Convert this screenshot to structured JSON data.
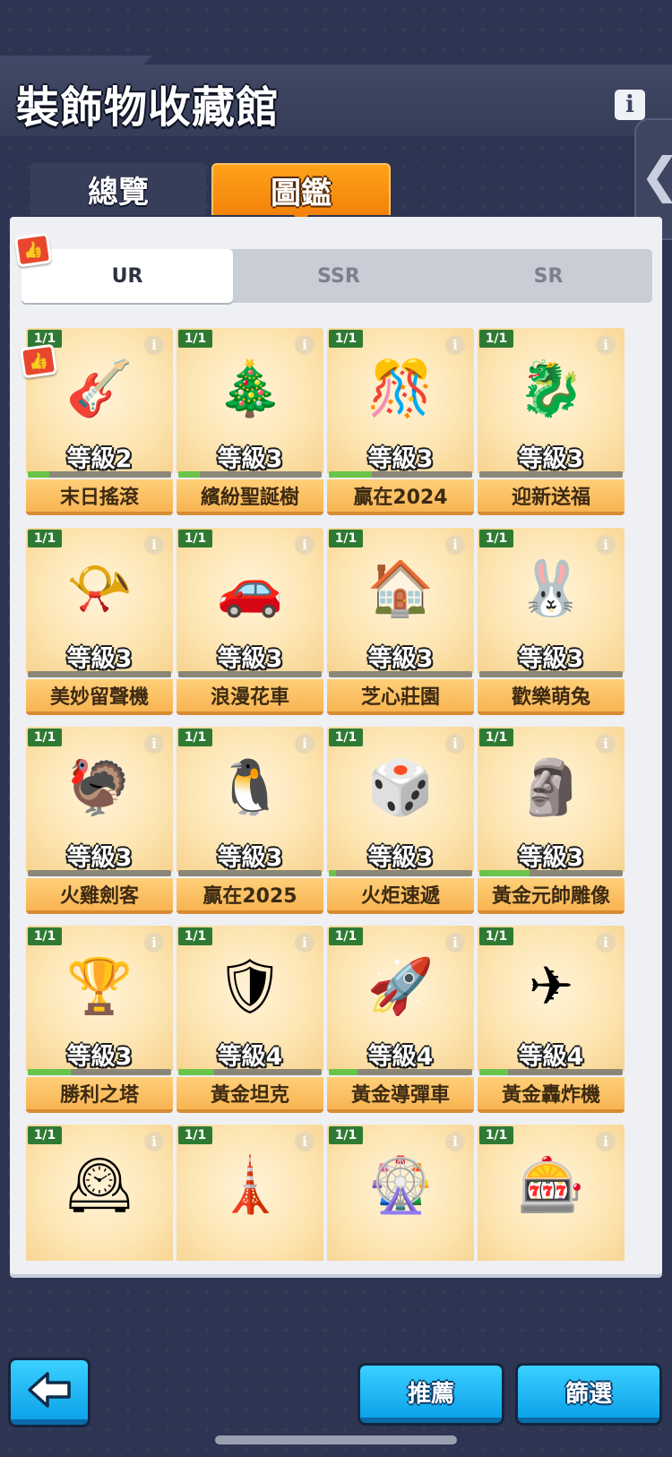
{
  "header": {
    "title": "裝飾物收藏館",
    "info_glyph": "i",
    "side_chevron": "❮"
  },
  "tabs": [
    {
      "label": "總覽",
      "active": false
    },
    {
      "label": "圖鑑",
      "active": true
    }
  ],
  "rarity_tabs": [
    {
      "label": "UR",
      "active": true
    },
    {
      "label": "SSR",
      "active": false
    },
    {
      "label": "SR",
      "active": false
    }
  ],
  "colors": {
    "accent_orange": "#f2820a",
    "button_blue": "#0ea2ea",
    "count_badge_green": "#2f7a33",
    "progress_green": "#6bc44a"
  },
  "items": [
    {
      "count": "1/1",
      "level": "等級2",
      "name": "末日搖滾",
      "progress": 0.15,
      "icon": "guitar-zombie-icon",
      "glyph": "🎸"
    },
    {
      "count": "1/1",
      "level": "等級3",
      "name": "繽紛聖誕樹",
      "progress": 0.15,
      "icon": "christmas-tree-icon",
      "glyph": "🎄"
    },
    {
      "count": "1/1",
      "level": "等級3",
      "name": "贏在2024",
      "progress": 0.3,
      "icon": "2024-sign-icon",
      "glyph": "🎊"
    },
    {
      "count": "1/1",
      "level": "等級3",
      "name": "迎新送福",
      "progress": 0.0,
      "icon": "dragon-icon",
      "glyph": "🐉"
    },
    {
      "count": "1/1",
      "level": "等級3",
      "name": "美妙留聲機",
      "progress": 0.0,
      "icon": "gramophone-icon",
      "glyph": "📯"
    },
    {
      "count": "1/1",
      "level": "等級3",
      "name": "浪漫花車",
      "progress": 0.0,
      "icon": "pink-car-icon",
      "glyph": "🚗"
    },
    {
      "count": "1/1",
      "level": "等級3",
      "name": "芝心莊園",
      "progress": 0.0,
      "icon": "bow-house-icon",
      "glyph": "🏠"
    },
    {
      "count": "1/1",
      "level": "等級3",
      "name": "歡樂萌兔",
      "progress": 0.0,
      "icon": "bunny-icon",
      "glyph": "🐰"
    },
    {
      "count": "1/1",
      "level": "等級3",
      "name": "火雞劍客",
      "progress": 0.0,
      "icon": "turkey-icon",
      "glyph": "🦃"
    },
    {
      "count": "1/1",
      "level": "等級3",
      "name": "贏在2025",
      "progress": 0.0,
      "icon": "2025-sign-icon",
      "glyph": "🐧"
    },
    {
      "count": "1/1",
      "level": "等級3",
      "name": "火炬速遞",
      "progress": 0.05,
      "icon": "torch-statue-icon",
      "glyph": "🎲"
    },
    {
      "count": "1/1",
      "level": "等級3",
      "name": "黃金元帥雕像",
      "progress": 0.35,
      "icon": "marshal-statue-icon",
      "glyph": "🗿"
    },
    {
      "count": "1/1",
      "level": "等級3",
      "name": "勝利之塔",
      "progress": 0.3,
      "icon": "victory-tower-icon",
      "glyph": "🏆"
    },
    {
      "count": "1/1",
      "level": "等級4",
      "name": "黃金坦克",
      "progress": 0.25,
      "icon": "golden-tank-icon",
      "glyph": "🛡"
    },
    {
      "count": "1/1",
      "level": "等級4",
      "name": "黃金導彈車",
      "progress": 0.2,
      "icon": "golden-missile-truck-icon",
      "glyph": "🚀"
    },
    {
      "count": "1/1",
      "level": "等級4",
      "name": "黃金轟炸機",
      "progress": 0.2,
      "icon": "golden-bomber-icon",
      "glyph": "✈"
    },
    {
      "count": "1/1",
      "level": "",
      "name": "",
      "progress": 0.0,
      "icon": "big-ben-icon",
      "glyph": "🕰"
    },
    {
      "count": "1/1",
      "level": "",
      "name": "",
      "progress": 0.0,
      "icon": "eiffel-tower-icon",
      "glyph": "🗼"
    },
    {
      "count": "1/1",
      "level": "",
      "name": "",
      "progress": 0.0,
      "icon": "ferris-wheel-icon",
      "glyph": "🎡"
    },
    {
      "count": "1/1",
      "level": "",
      "name": "",
      "progress": 0.0,
      "icon": "las-vegas-sign-icon",
      "glyph": "🎰"
    }
  ],
  "footer": {
    "back_icon": "back-arrow-icon",
    "recommend_label": "推薦",
    "filter_label": "篩選"
  }
}
